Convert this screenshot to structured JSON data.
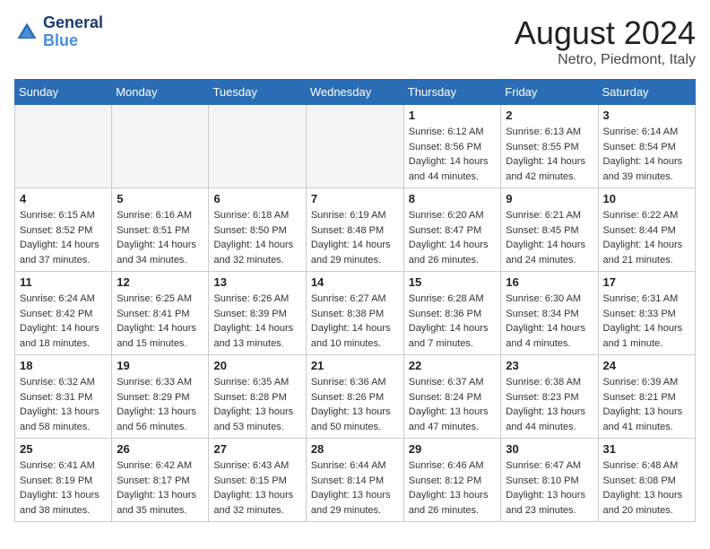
{
  "header": {
    "logo_line1": "General",
    "logo_line2": "Blue",
    "month_title": "August 2024",
    "location": "Netro, Piedmont, Italy"
  },
  "weekdays": [
    "Sunday",
    "Monday",
    "Tuesday",
    "Wednesday",
    "Thursday",
    "Friday",
    "Saturday"
  ],
  "weeks": [
    [
      {
        "day": "",
        "info": ""
      },
      {
        "day": "",
        "info": ""
      },
      {
        "day": "",
        "info": ""
      },
      {
        "day": "",
        "info": ""
      },
      {
        "day": "1",
        "info": "Sunrise: 6:12 AM\nSunset: 8:56 PM\nDaylight: 14 hours\nand 44 minutes."
      },
      {
        "day": "2",
        "info": "Sunrise: 6:13 AM\nSunset: 8:55 PM\nDaylight: 14 hours\nand 42 minutes."
      },
      {
        "day": "3",
        "info": "Sunrise: 6:14 AM\nSunset: 8:54 PM\nDaylight: 14 hours\nand 39 minutes."
      }
    ],
    [
      {
        "day": "4",
        "info": "Sunrise: 6:15 AM\nSunset: 8:52 PM\nDaylight: 14 hours\nand 37 minutes."
      },
      {
        "day": "5",
        "info": "Sunrise: 6:16 AM\nSunset: 8:51 PM\nDaylight: 14 hours\nand 34 minutes."
      },
      {
        "day": "6",
        "info": "Sunrise: 6:18 AM\nSunset: 8:50 PM\nDaylight: 14 hours\nand 32 minutes."
      },
      {
        "day": "7",
        "info": "Sunrise: 6:19 AM\nSunset: 8:48 PM\nDaylight: 14 hours\nand 29 minutes."
      },
      {
        "day": "8",
        "info": "Sunrise: 6:20 AM\nSunset: 8:47 PM\nDaylight: 14 hours\nand 26 minutes."
      },
      {
        "day": "9",
        "info": "Sunrise: 6:21 AM\nSunset: 8:45 PM\nDaylight: 14 hours\nand 24 minutes."
      },
      {
        "day": "10",
        "info": "Sunrise: 6:22 AM\nSunset: 8:44 PM\nDaylight: 14 hours\nand 21 minutes."
      }
    ],
    [
      {
        "day": "11",
        "info": "Sunrise: 6:24 AM\nSunset: 8:42 PM\nDaylight: 14 hours\nand 18 minutes."
      },
      {
        "day": "12",
        "info": "Sunrise: 6:25 AM\nSunset: 8:41 PM\nDaylight: 14 hours\nand 15 minutes."
      },
      {
        "day": "13",
        "info": "Sunrise: 6:26 AM\nSunset: 8:39 PM\nDaylight: 14 hours\nand 13 minutes."
      },
      {
        "day": "14",
        "info": "Sunrise: 6:27 AM\nSunset: 8:38 PM\nDaylight: 14 hours\nand 10 minutes."
      },
      {
        "day": "15",
        "info": "Sunrise: 6:28 AM\nSunset: 8:36 PM\nDaylight: 14 hours\nand 7 minutes."
      },
      {
        "day": "16",
        "info": "Sunrise: 6:30 AM\nSunset: 8:34 PM\nDaylight: 14 hours\nand 4 minutes."
      },
      {
        "day": "17",
        "info": "Sunrise: 6:31 AM\nSunset: 8:33 PM\nDaylight: 14 hours\nand 1 minute."
      }
    ],
    [
      {
        "day": "18",
        "info": "Sunrise: 6:32 AM\nSunset: 8:31 PM\nDaylight: 13 hours\nand 58 minutes."
      },
      {
        "day": "19",
        "info": "Sunrise: 6:33 AM\nSunset: 8:29 PM\nDaylight: 13 hours\nand 56 minutes."
      },
      {
        "day": "20",
        "info": "Sunrise: 6:35 AM\nSunset: 8:28 PM\nDaylight: 13 hours\nand 53 minutes."
      },
      {
        "day": "21",
        "info": "Sunrise: 6:36 AM\nSunset: 8:26 PM\nDaylight: 13 hours\nand 50 minutes."
      },
      {
        "day": "22",
        "info": "Sunrise: 6:37 AM\nSunset: 8:24 PM\nDaylight: 13 hours\nand 47 minutes."
      },
      {
        "day": "23",
        "info": "Sunrise: 6:38 AM\nSunset: 8:23 PM\nDaylight: 13 hours\nand 44 minutes."
      },
      {
        "day": "24",
        "info": "Sunrise: 6:39 AM\nSunset: 8:21 PM\nDaylight: 13 hours\nand 41 minutes."
      }
    ],
    [
      {
        "day": "25",
        "info": "Sunrise: 6:41 AM\nSunset: 8:19 PM\nDaylight: 13 hours\nand 38 minutes."
      },
      {
        "day": "26",
        "info": "Sunrise: 6:42 AM\nSunset: 8:17 PM\nDaylight: 13 hours\nand 35 minutes."
      },
      {
        "day": "27",
        "info": "Sunrise: 6:43 AM\nSunset: 8:15 PM\nDaylight: 13 hours\nand 32 minutes."
      },
      {
        "day": "28",
        "info": "Sunrise: 6:44 AM\nSunset: 8:14 PM\nDaylight: 13 hours\nand 29 minutes."
      },
      {
        "day": "29",
        "info": "Sunrise: 6:46 AM\nSunset: 8:12 PM\nDaylight: 13 hours\nand 26 minutes."
      },
      {
        "day": "30",
        "info": "Sunrise: 6:47 AM\nSunset: 8:10 PM\nDaylight: 13 hours\nand 23 minutes."
      },
      {
        "day": "31",
        "info": "Sunrise: 6:48 AM\nSunset: 8:08 PM\nDaylight: 13 hours\nand 20 minutes."
      }
    ]
  ]
}
